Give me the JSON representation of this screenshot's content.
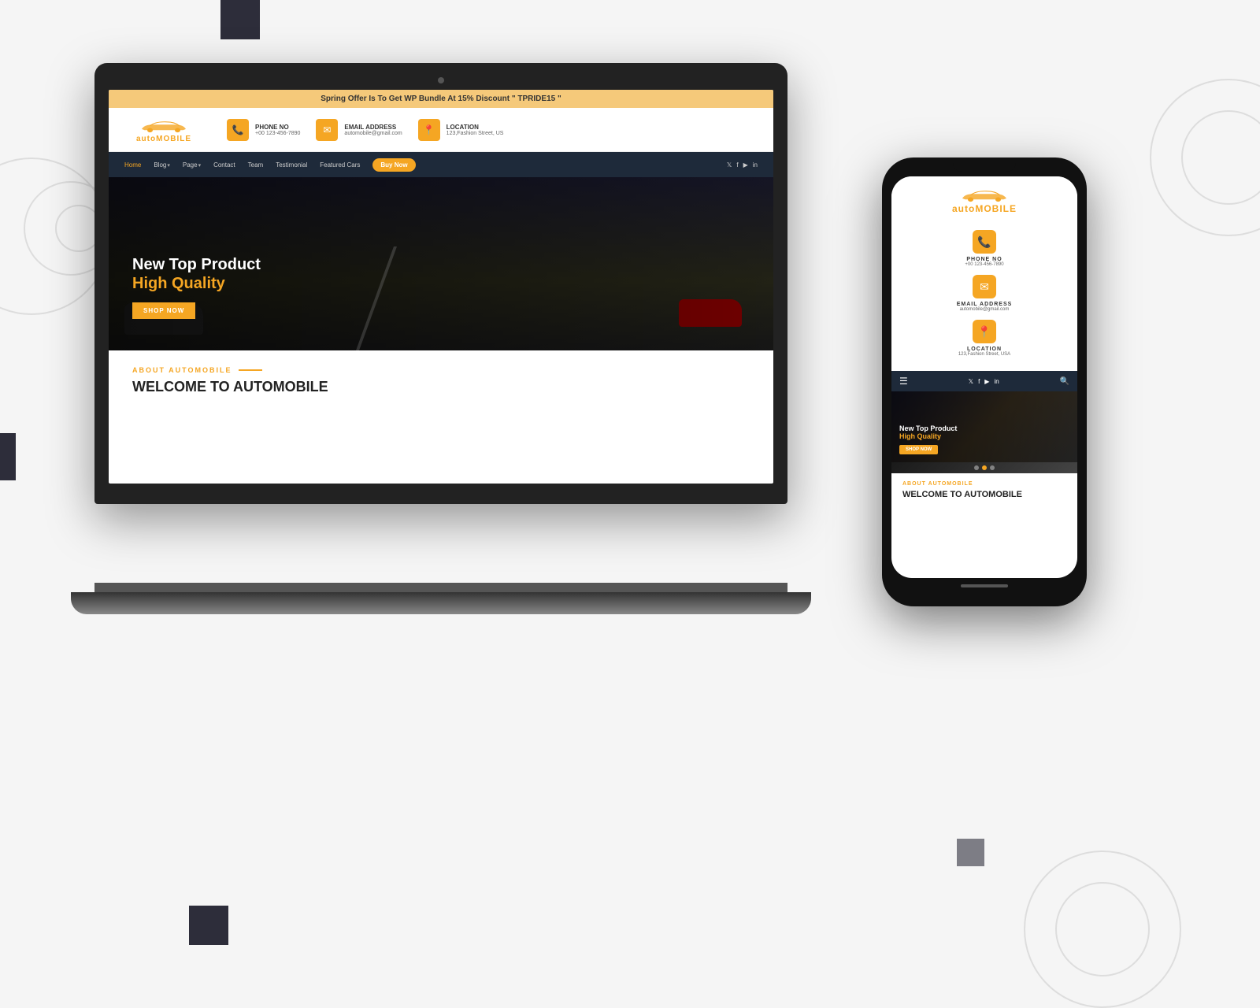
{
  "background": {
    "color": "#f0f0f0"
  },
  "laptop": {
    "screen": {
      "banner": {
        "text": "Spring Offer Is To Get WP Bundle At 15% Discount \" TPRIDE15 \""
      },
      "header": {
        "logo": {
          "text_auto": "auto",
          "text_mobile": "MOBILE"
        },
        "contact": [
          {
            "icon": "📞",
            "label": "PHONE NO",
            "value": "+00 123-456-7890"
          },
          {
            "icon": "✉",
            "label": "EMAIL ADDRESS",
            "value": "automobile@gmail.com"
          },
          {
            "icon": "📍",
            "label": "LOCATION",
            "value": "123,Fashion Street, US"
          }
        ]
      },
      "nav": {
        "items": [
          "Home",
          "Blog",
          "Page",
          "Contact",
          "Team",
          "Testimonial",
          "Featured Cars"
        ],
        "cta": "Buy Now",
        "socials": [
          "𝕏",
          "f",
          "▶",
          "in"
        ]
      },
      "hero": {
        "title_line1": "New Top Product",
        "title_line2_prefix": "High ",
        "title_line2_highlight": "Quality",
        "cta": "SHOP NOW"
      },
      "about": {
        "label": "ABOUT AUTOMOBILE",
        "title": "WELCOME TO AUTOMOBILE"
      }
    }
  },
  "phone": {
    "screen": {
      "logo": {
        "text_auto": "auto",
        "text_mobile": "MOBILE"
      },
      "contact": [
        {
          "icon": "📞",
          "label": "PHONE NO",
          "value": "+00 123-456-7890"
        },
        {
          "icon": "✉",
          "label": "EMAIL ADDRESS",
          "value": "automobile@gmail.com"
        },
        {
          "icon": "📍",
          "label": "LOCATION",
          "value": "123,Fashion Street, USA"
        }
      ],
      "nav": {
        "socials": [
          "𝕏",
          "f",
          "▶",
          "in"
        ]
      },
      "hero": {
        "title_line1": "New Top Product",
        "title_line2_prefix": "High ",
        "title_line2_highlight": "Quality",
        "cta": "SHOP NOW"
      },
      "about": {
        "label": "ABOUT AUTOMOBILE",
        "title": "WELCOME TO AUTOMOBILE"
      }
    }
  },
  "colors": {
    "accent": "#f5a623",
    "dark_nav": "#1e2a3a",
    "text_dark": "#222222",
    "text_light": "#ffffff"
  }
}
